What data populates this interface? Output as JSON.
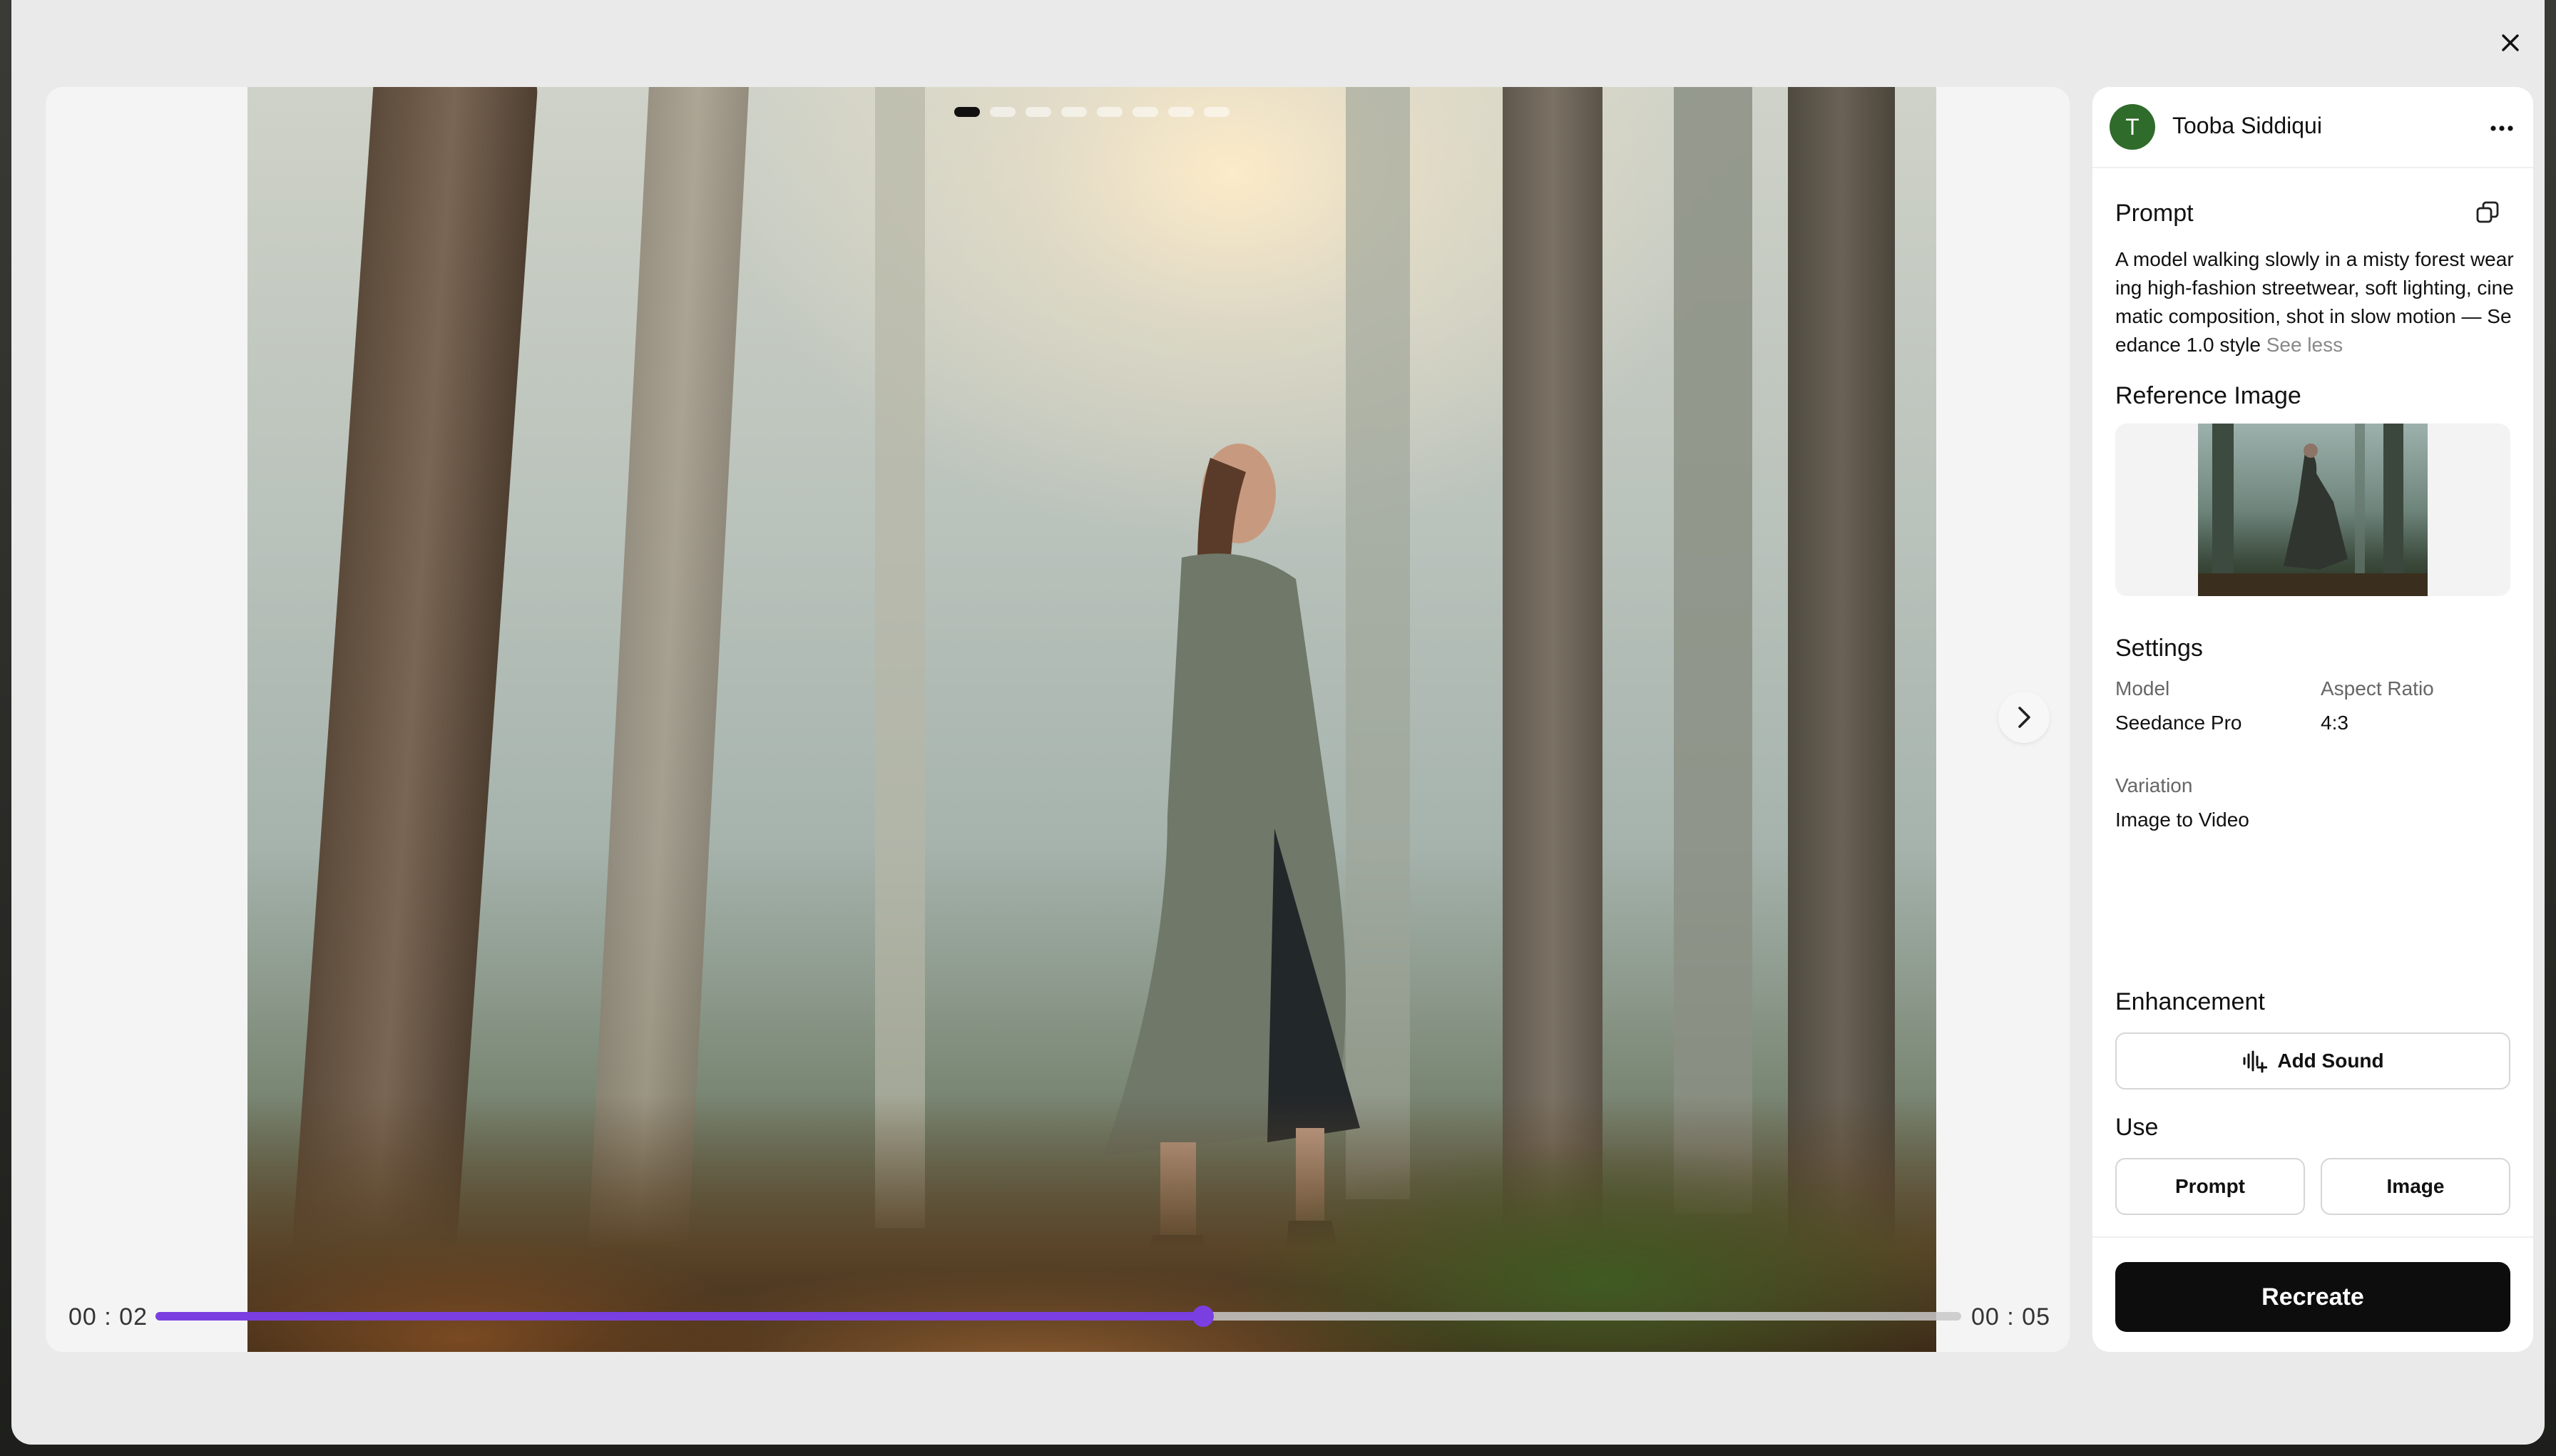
{
  "player": {
    "current_time": "00 : 02",
    "total_time": "00 : 05",
    "progress": 0.58,
    "slide_count": 8,
    "active_slide": 1
  },
  "user": {
    "avatar_initial": "T",
    "name": "Tooba Siddiqui"
  },
  "prompt": {
    "title": "Prompt",
    "text": "A model walking slowly in a misty forest wearing high-fashion streetwear, soft lighting, cinematic composition, shot in slow motion — Seedance 1.0 style",
    "toggle_label": "See less"
  },
  "reference": {
    "title": "Reference Image"
  },
  "settings": {
    "title": "Settings",
    "model_label": "Model",
    "model_value": "Seedance Pro",
    "aspect_label": "Aspect Ratio",
    "aspect_value": "4:3",
    "variation_label": "Variation",
    "variation_value": "Image to Video"
  },
  "enhancement": {
    "title": "Enhancement",
    "add_sound_label": "Add Sound"
  },
  "use": {
    "title": "Use",
    "prompt_label": "Prompt",
    "image_label": "Image"
  },
  "actions": {
    "recreate_label": "Recreate"
  },
  "colors": {
    "accent": "#7a3fe0",
    "avatar_bg": "#2f6b2a",
    "primary_button": "#0d0d0d"
  },
  "icons": {
    "close": "close-icon",
    "next": "chevron-right-icon",
    "more": "more-horizontal-icon",
    "copy": "copy-icon",
    "sound": "sound-wave-plus-icon"
  }
}
